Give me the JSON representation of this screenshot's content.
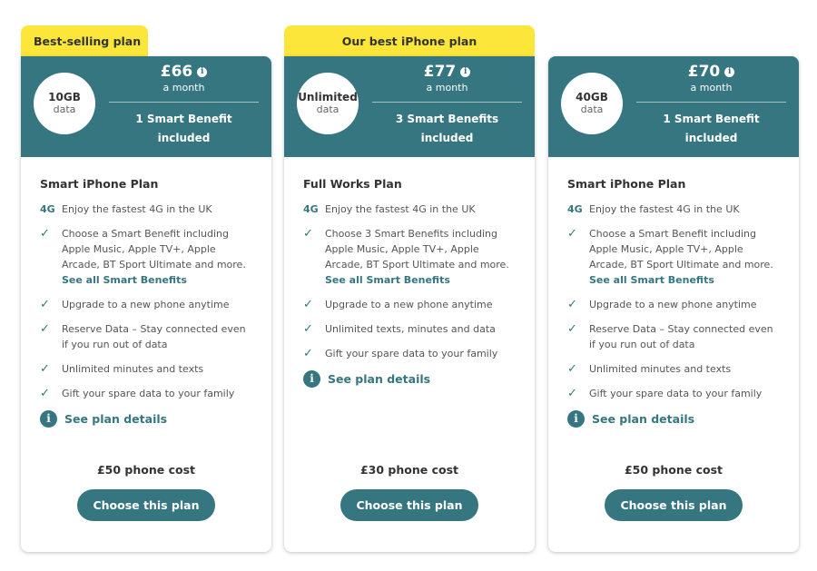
{
  "colors": {
    "accent": "#357680",
    "ribbon": "#fce63a",
    "text": "#333333"
  },
  "plans": [
    {
      "ribbon": "Best-selling plan",
      "data_amount": "10GB",
      "data_unit": "data",
      "price": "£66",
      "per": "a month",
      "benefits_line1": "1 Smart Benefit",
      "benefits_line2": "included",
      "name": "Smart iPhone Plan",
      "tag_4g": "4G",
      "feature_4g": "Enjoy the fastest 4G in the UK",
      "smart_benefit_text": "Choose a Smart Benefit including Apple Music, Apple TV+, Apple Arcade, BT Sport Ultimate and more.",
      "smart_benefit_link": "See all Smart Benefits",
      "features": [
        "Upgrade to a new phone anytime",
        "Reserve Data – Stay connected even if you run out of data",
        "Unlimited minutes and texts",
        "Gift your spare data to your family"
      ],
      "details_link": "See plan details",
      "phone_cost": "£50 phone cost",
      "cta": "Choose this plan"
    },
    {
      "ribbon": "Our best iPhone plan",
      "data_amount": "Unlimited",
      "data_unit": "data",
      "price": "£77",
      "per": "a month",
      "benefits_line1": "3 Smart Benefits",
      "benefits_line2": "included",
      "name": "Full Works Plan",
      "tag_4g": "4G",
      "feature_4g": "Enjoy the fastest 4G in the UK",
      "smart_benefit_text": "Choose 3 Smart Benefits including Apple Music, Apple TV+, Apple Arcade, BT Sport Ultimate and more.",
      "smart_benefit_link": "See all Smart Benefits",
      "features": [
        "Upgrade to a new phone anytime",
        "Unlimited texts, minutes and data",
        "Gift your spare data to your family"
      ],
      "details_link": "See plan details",
      "phone_cost": "£30 phone cost",
      "cta": "Choose this plan"
    },
    {
      "ribbon": "",
      "data_amount": "40GB",
      "data_unit": "data",
      "price": "£70",
      "per": "a month",
      "benefits_line1": "1 Smart Benefit",
      "benefits_line2": "included",
      "name": "Smart iPhone Plan",
      "tag_4g": "4G",
      "feature_4g": "Enjoy the fastest 4G in the UK",
      "smart_benefit_text": "Choose a Smart Benefit including Apple Music, Apple TV+, Apple Arcade, BT Sport Ultimate and more.",
      "smart_benefit_link": "See all Smart Benefits",
      "features": [
        "Upgrade to a new phone anytime",
        "Reserve Data – Stay connected even if you run out of data",
        "Unlimited minutes and texts",
        "Gift your spare data to your family"
      ],
      "details_link": "See plan details",
      "phone_cost": "£50 phone cost",
      "cta": "Choose this plan"
    }
  ]
}
